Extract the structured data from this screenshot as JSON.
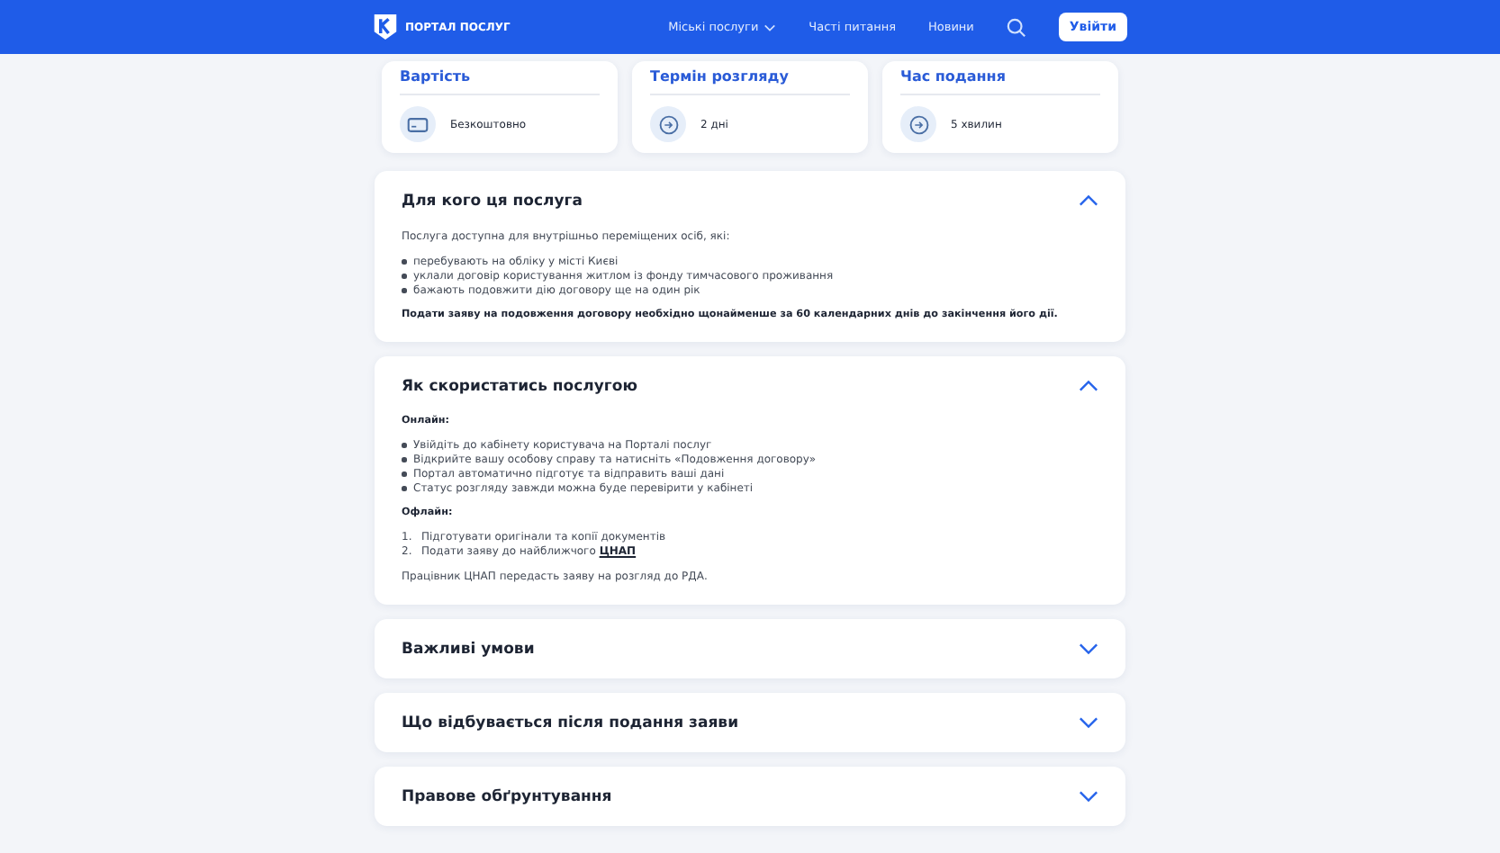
{
  "header": {
    "logo_title": "ПОРТАЛ ПОСЛУГ",
    "nav": [
      {
        "label": "Міські послуги",
        "has_dropdown": true
      },
      {
        "label": "Часті питання",
        "has_dropdown": false
      },
      {
        "label": "Новини",
        "has_dropdown": false
      }
    ],
    "login_button": "Увійти"
  },
  "info_cards": [
    {
      "title": "Вартість",
      "value": "Безкоштовно",
      "kind": "money"
    },
    {
      "title": "Термін розгляду",
      "value": "2 дні",
      "kind": "arrow"
    },
    {
      "title": "Час подання",
      "value": "5 хвилин",
      "kind": "arrow"
    }
  ],
  "sections": [
    {
      "title": "Для кого ця послуга",
      "expanded": true,
      "blocks": [
        {
          "kind": "text",
          "text": "Послуга доступна для внутрішньо переміщених осіб, які:"
        },
        {
          "kind": "bullets",
          "items": [
            "перебувають на обліку у місті Києві",
            "уклали договір користування житлом із фонду тимчасового проживання",
            "бажають подовжити дію договору ще на один рік"
          ]
        },
        {
          "kind": "bold",
          "text": "Подати заяву на подовження договору необхідно щонайменше за 60 календарних днів до закінчення його дії."
        }
      ]
    },
    {
      "title": "Як скористатись послугою",
      "expanded": true,
      "blocks": [
        {
          "kind": "bold",
          "text": "Онлайн:"
        },
        {
          "kind": "bullets",
          "items": [
            "Увійдіть до кабінету користувача на Порталі послуг",
            "Відкрийте вашу особову справу та натисніть «Подовження договору»",
            "Портал автоматично підготує та відправить ваші дані",
            "Статус розгляду завжди можна буде перевірити у кабінеті"
          ]
        },
        {
          "kind": "bold",
          "text": "Офлайн:"
        },
        {
          "kind": "numbered",
          "items": [
            {
              "number": "1.",
              "text": "Підготувати оригінали та копії документів"
            },
            {
              "number": "2.",
              "text": "Подати заяву до найближчого",
              "link": "ЦНАП"
            }
          ]
        },
        {
          "kind": "text",
          "text": "Працівник ЦНАП передасть заяву на розгляд до РДА."
        }
      ]
    },
    {
      "title": "Важливі умови",
      "expanded": false
    },
    {
      "title": "Що відбувається після подання заяви",
      "expanded": false
    },
    {
      "title": "Правове обґрунтування",
      "expanded": false
    }
  ]
}
